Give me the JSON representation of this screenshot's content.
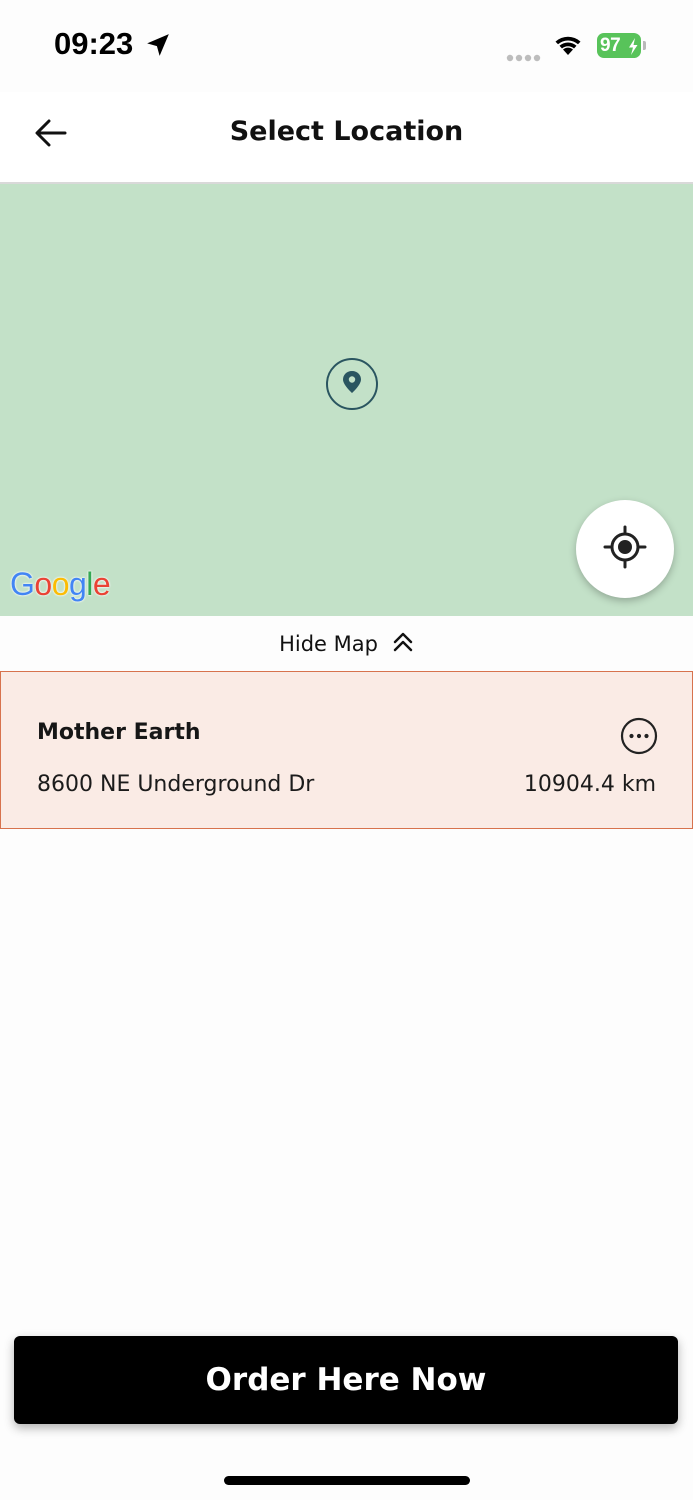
{
  "status_bar": {
    "time": "09:23",
    "battery": "97",
    "battery_color": "#58c35a"
  },
  "header": {
    "title": "Select Location",
    "back_icon": "arrow-left-icon"
  },
  "map": {
    "background_color": "#c3e1c8",
    "attribution": "Google",
    "pin_icon": "map-pin-icon",
    "locate_icon": "crosshair-icon"
  },
  "map_toggle": {
    "label": "Hide Map",
    "icon": "double-chevron-up-icon"
  },
  "location": {
    "name": "Mother Earth",
    "address": "8600 NE Underground Dr",
    "distance": "10904.4 km",
    "more_icon": "more-horizontal-icon",
    "highlight_color": "#faebe5",
    "border_color": "#d7724d"
  },
  "cta": {
    "label": "Order Here Now"
  }
}
